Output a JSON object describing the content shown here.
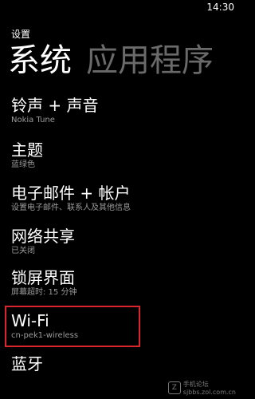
{
  "status_bar": {
    "time": "14:30"
  },
  "header": {
    "app_title": "设置"
  },
  "pivot": {
    "active": "系统",
    "next": "应用程序"
  },
  "items": [
    {
      "title": "铃声 + 声音",
      "subtitle": "Nokia Tune"
    },
    {
      "title": "主题",
      "subtitle": "蓝绿色"
    },
    {
      "title": "电子邮件 + 帐户",
      "subtitle": "设置电子邮件、联系人及其他信息"
    },
    {
      "title": "网络共享",
      "subtitle": "已关闭"
    },
    {
      "title": "锁屏界面",
      "subtitle": "屏幕超时: 15 分钟"
    },
    {
      "title": "Wi-Fi",
      "subtitle": "cn-pek1-wireless"
    },
    {
      "title": "蓝牙",
      "subtitle": ""
    }
  ],
  "highlight_color": "#d9252b",
  "watermark": {
    "logo_text": "Z",
    "line1": "手机论坛",
    "line2": "sjbbs.zol.com.cn"
  }
}
